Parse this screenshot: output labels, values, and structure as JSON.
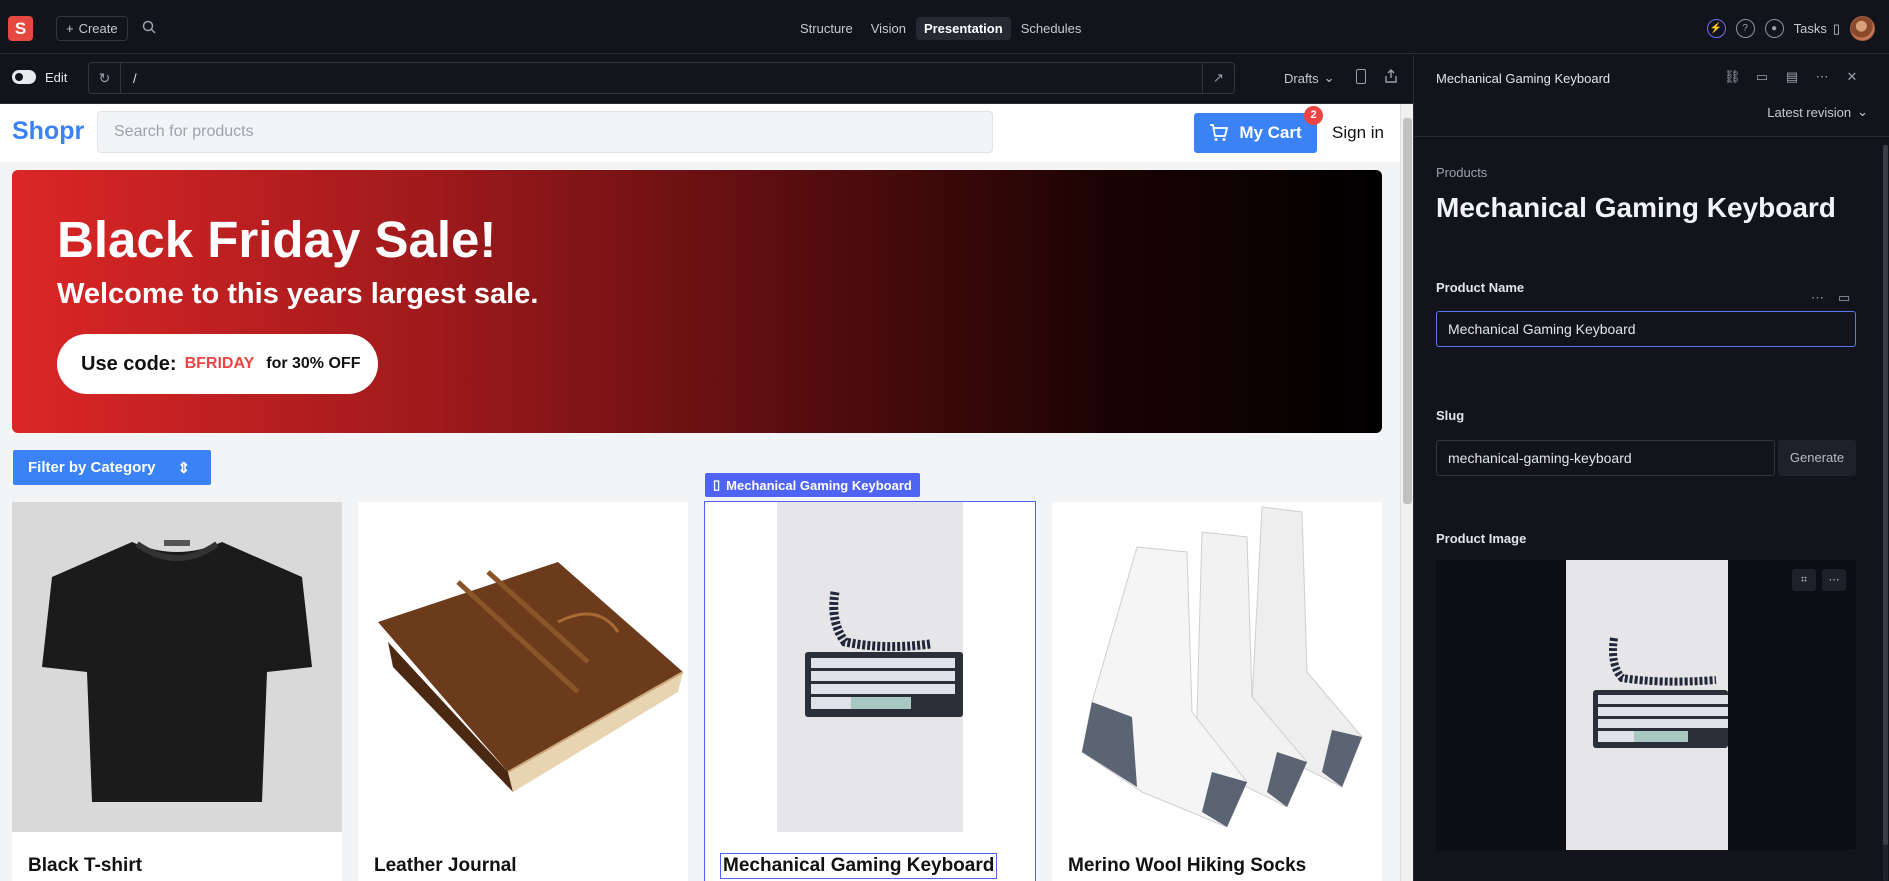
{
  "topbar": {
    "logo": "S",
    "create_label": "Create",
    "nav": [
      "Structure",
      "Vision",
      "Presentation",
      "Schedules"
    ],
    "nav_active": "Presentation",
    "tasks_label": "Tasks"
  },
  "urlbar": {
    "edit_label": "Edit",
    "url": "/",
    "drafts_label": "Drafts"
  },
  "shop": {
    "brand": "Shopr",
    "search_placeholder": "Search for products",
    "cart_label": "My Cart",
    "cart_count": "2",
    "signin_label": "Sign in",
    "banner": {
      "title": "Black Friday Sale!",
      "subtitle": "Welcome to this years largest sale.",
      "code_prefix": "Use code:",
      "code": "BFRIDAY",
      "code_suffix": "for 30% OFF"
    },
    "filter_label": "Filter by Category",
    "selected_tag": "Mechanical Gaming Keyboard",
    "products": [
      {
        "name": "Black T-shirt"
      },
      {
        "name": "Leather Journal"
      },
      {
        "name": "Mechanical Gaming Keyboard"
      },
      {
        "name": "Merino Wool Hiking Socks"
      }
    ]
  },
  "panel": {
    "title": "Mechanical Gaming Keyboard",
    "revision_label": "Latest revision",
    "breadcrumb": "Products",
    "doc_title": "Mechanical Gaming Keyboard",
    "product_name_label": "Product Name",
    "product_name_value": "Mechanical Gaming Keyboard",
    "slug_label": "Slug",
    "slug_value": "mechanical-gaming-keyboard",
    "generate_label": "Generate",
    "image_label": "Product Image"
  },
  "colors": {
    "accent": "#3b82f6",
    "brand_red": "#e4483f",
    "selection": "#4f63f5",
    "promo_code": "#ef4444"
  }
}
